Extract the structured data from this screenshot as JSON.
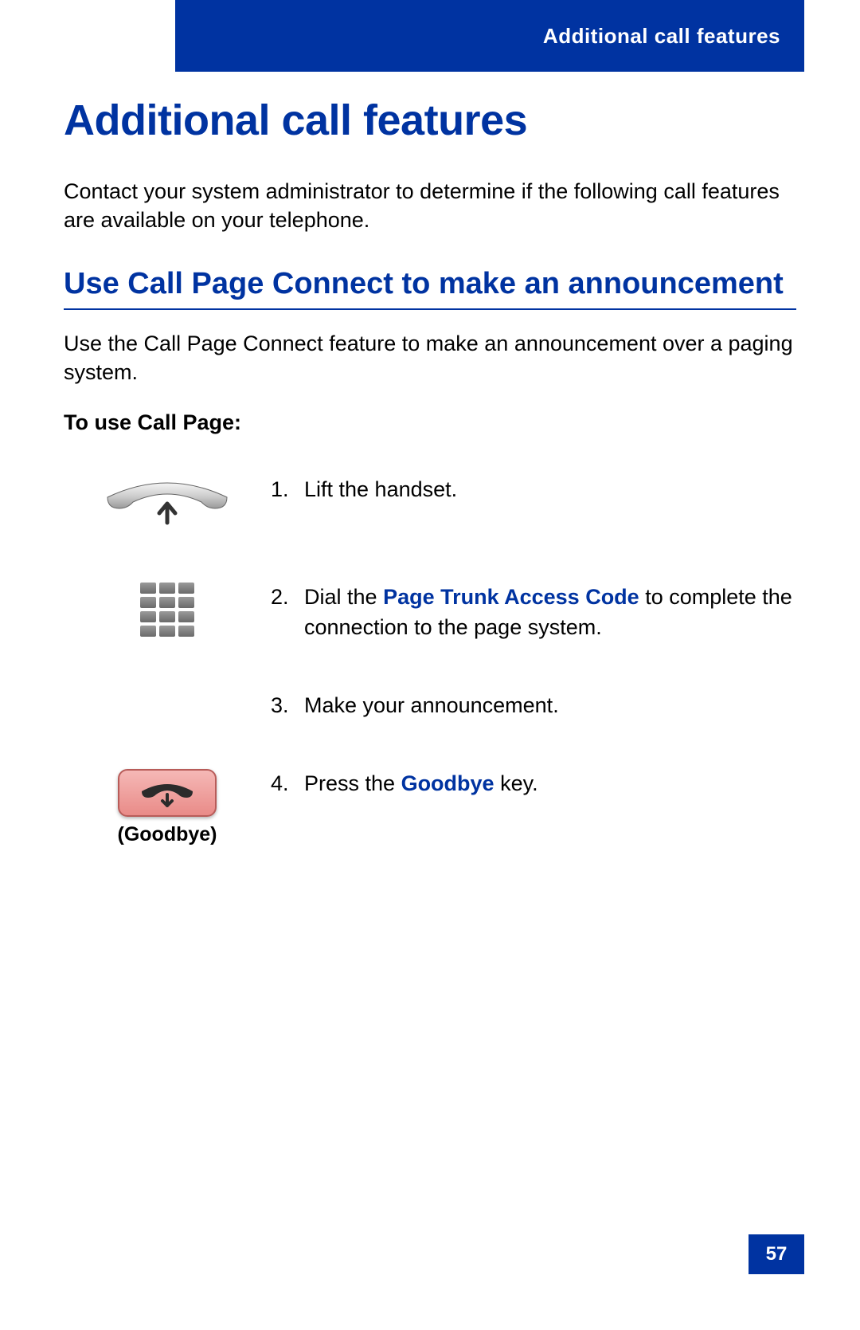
{
  "header": {
    "tab_label": "Additional call features"
  },
  "page": {
    "title": "Additional call features",
    "intro": "Contact your system administrator to determine if the following call features are available on your telephone.",
    "number": "57"
  },
  "section": {
    "title": "Use Call Page Connect to make an announcement",
    "intro": "Use the Call Page Connect feature to make an announcement over a paging system.",
    "procedure_label": "To use Call Page:"
  },
  "steps": {
    "s1": {
      "num": "1.",
      "text": "Lift the handset."
    },
    "s2": {
      "num": "2.",
      "pre": "Dial the ",
      "link": "Page Trunk Access Code",
      "post": " to complete the connection to the page system."
    },
    "s3": {
      "num": "3.",
      "text": "Make your announcement."
    },
    "s4": {
      "num": "4.",
      "pre": "Press the ",
      "link": "Goodbye",
      "post": " key."
    }
  },
  "icons": {
    "goodbye_caption": "(Goodbye)"
  }
}
